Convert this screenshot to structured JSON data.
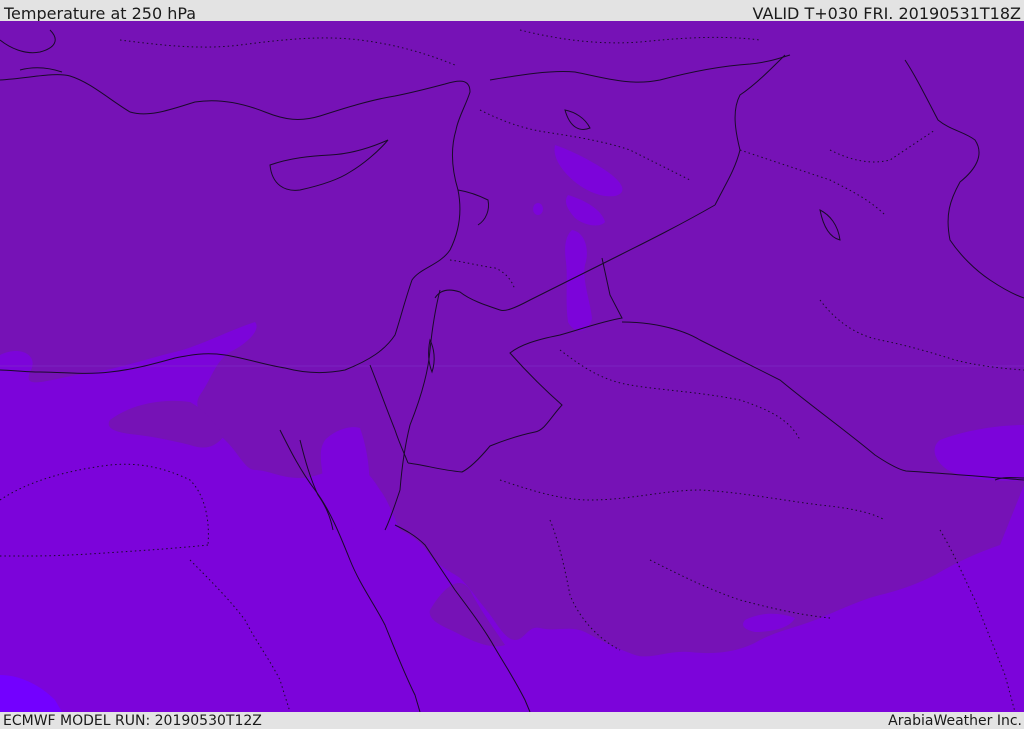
{
  "header": {
    "title": "Temperature at 250 hPa",
    "valid_time": "VALID T+030 FRI. 20190531T18Z"
  },
  "footer": {
    "model_run": "ECMWF MODEL RUN: 20190530T12Z",
    "credit": "ArabiaWeather Inc."
  },
  "map": {
    "colors": {
      "warmer_band": "#7612b6",
      "cooler_band": "#7c04da",
      "coldest_band": "#7300ff",
      "borders": "#1a0a2a"
    }
  }
}
